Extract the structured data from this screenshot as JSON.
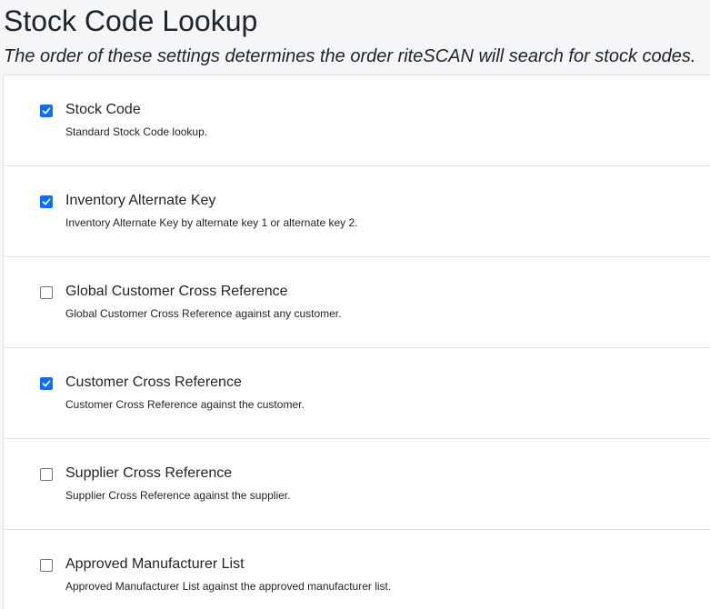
{
  "page": {
    "title": "Stock Code Lookup",
    "subtitle": "The order of these settings determines the order riteSCAN will search for stock codes."
  },
  "colors": {
    "accent": "#0d6efd",
    "border": "#dfe2e5",
    "text": "#212529"
  },
  "settings": [
    {
      "label": "Stock Code",
      "description": "Standard Stock Code lookup.",
      "checked": true
    },
    {
      "label": "Inventory Alternate Key",
      "description": "Inventory Alternate Key by alternate key 1 or alternate key 2.",
      "checked": true
    },
    {
      "label": "Global Customer Cross Reference",
      "description": "Global Customer Cross Reference against any customer.",
      "checked": false
    },
    {
      "label": "Customer Cross Reference",
      "description": "Customer Cross Reference against the customer.",
      "checked": true
    },
    {
      "label": "Supplier Cross Reference",
      "description": "Supplier Cross Reference against the supplier.",
      "checked": false
    },
    {
      "label": "Approved Manufacturer List",
      "description": "Approved Manufacturer List against the approved manufacturer list.",
      "checked": false
    }
  ]
}
